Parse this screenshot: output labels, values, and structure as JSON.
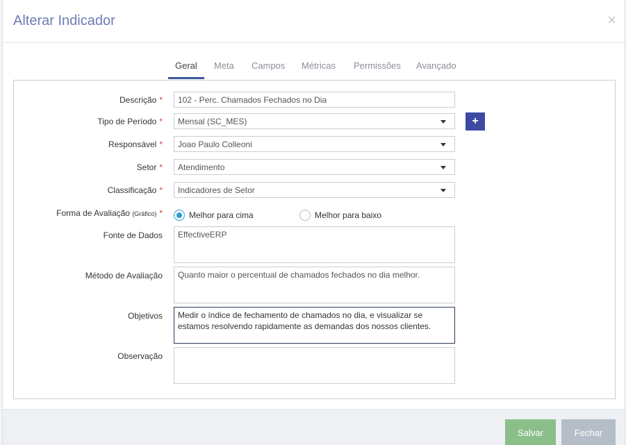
{
  "modal": {
    "title": "Alterar Indicador",
    "close_icon": "×"
  },
  "tabs": [
    "Geral",
    "Meta",
    "Campos",
    "Métricas",
    "Permissões",
    "Avançado"
  ],
  "active_tab": "Geral",
  "form": {
    "descricao": {
      "label": "Descrição",
      "required": "*",
      "value": "102 - Perc. Chamados Fechados no Dia"
    },
    "tipo_periodo": {
      "label": "Tipo de Período",
      "required": "*",
      "value": "Mensal (SC_MES)"
    },
    "responsavel": {
      "label": "Responsável",
      "required": "*",
      "value": "Joao Paulo Colleoni"
    },
    "setor": {
      "label": "Setor",
      "required": "*",
      "value": "Atendimento"
    },
    "classificacao": {
      "label": "Classificação",
      "required": "*",
      "value": "Indicadores de Setor"
    },
    "forma_avaliacao": {
      "label": "Forma de Avaliação",
      "label_small": "(Gráfico)",
      "required": "*",
      "options": [
        "Melhor para cima",
        "Melhor para baixo"
      ],
      "selected": "Melhor para cima"
    },
    "fonte_dados": {
      "label": "Fonte de Dados",
      "value": "EffectiveERP"
    },
    "metodo_avaliacao": {
      "label": "Método de Avaliação",
      "value": "Quanto maior o percentual de chamados fechados no dia melhor."
    },
    "objetivos": {
      "label": "Objetivos",
      "value": "Medir o índice de fechamento de chamados no dia, e visualizar se estamos resolvendo rapidamente as demandas dos nossos clientes."
    },
    "observacao": {
      "label": "Observação",
      "value": ""
    }
  },
  "buttons": {
    "add": "+",
    "save": "Salvar",
    "close": "Fechar"
  },
  "colors": {
    "title": "#6c7bb6",
    "tab_active_underline": "#3d5a9e",
    "required": "#d63b3b",
    "plus_button": "#3d4aa3",
    "radio_checked": "#2a9fd6",
    "save_button": "#8bbf8a",
    "close_button": "#b5bec8"
  },
  "icons": {
    "close": "close-icon",
    "dropdown": "chevron-down-icon",
    "add": "plus-icon"
  }
}
